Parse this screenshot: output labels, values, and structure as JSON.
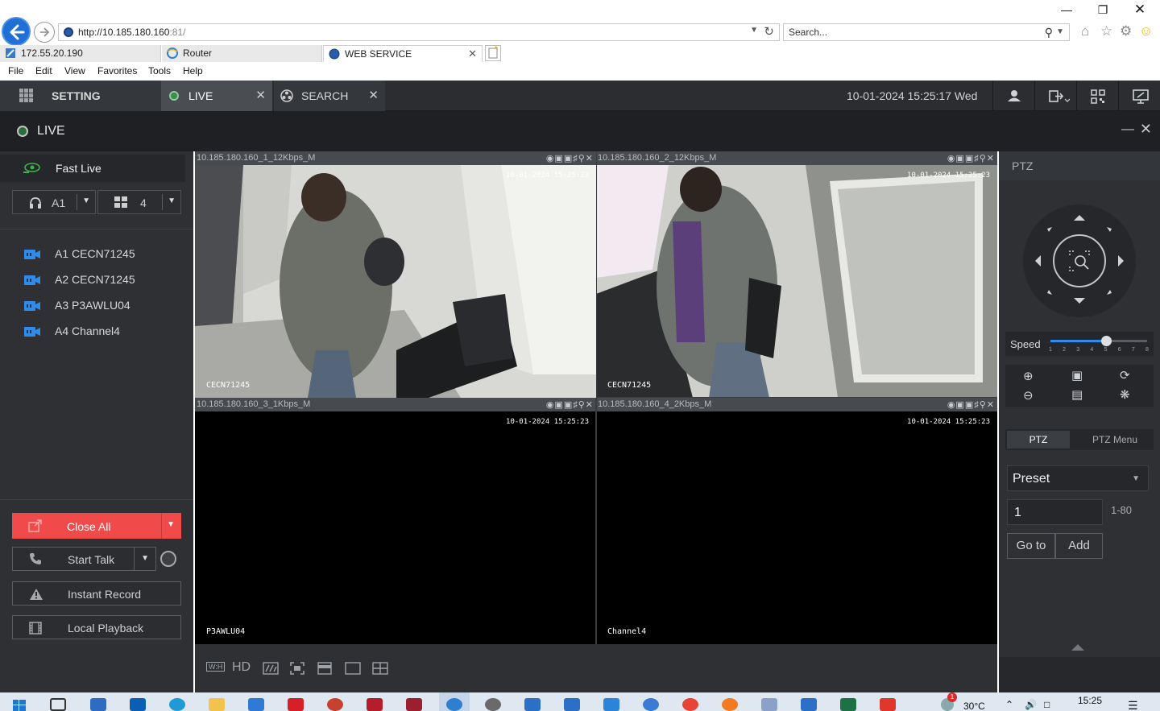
{
  "browser": {
    "address_url_host": "http://10.185.180.160",
    "address_url_rest": ":81/",
    "search_placeholder": "Search...",
    "tabs": [
      {
        "label": "172.55.20.190"
      },
      {
        "label": "Router"
      },
      {
        "label": "WEB SERVICE"
      }
    ],
    "menu": [
      "File",
      "Edit",
      "View",
      "Favorites",
      "Tools",
      "Help"
    ]
  },
  "app_header": {
    "setting_label": "SETTING",
    "live_label": "LIVE",
    "search_label": "SEARCH",
    "datetime": "10-01-2024 15:25:17 Wed"
  },
  "live_bar": {
    "title": "LIVE"
  },
  "left_panel": {
    "fast_live_label": "Fast Live",
    "stream_select": "A1",
    "layout_select": "4",
    "channels": [
      {
        "label": "A1 CECN71245"
      },
      {
        "label": "A2 CECN71245"
      },
      {
        "label": "A3 P3AWLU04"
      },
      {
        "label": "A4 Channel4"
      }
    ],
    "close_all_label": "Close All",
    "start_talk_label": "Start Talk",
    "instant_record_label": "Instant Record",
    "local_playback_label": "Local Playback"
  },
  "video_cells": [
    {
      "title": "10.185.180.160_1_12Kbps_M",
      "osd_time": "10-01-2024 15:25:23",
      "osd_name": "CECN71245"
    },
    {
      "title": "10.185.180.160_2_12Kbps_M",
      "osd_time": "10-01-2024 15:25:23",
      "osd_name": "CECN71245"
    },
    {
      "title": "10.185.180.160_3_1Kbps_M",
      "osd_time": "10-01-2024 15:25:23",
      "osd_name": "P3AWLU04"
    },
    {
      "title": "10.185.180.160_4_2Kbps_M",
      "osd_time": "10-01-2024 15:25:23",
      "osd_name": "Channel4"
    }
  ],
  "bottom_toolbar": {
    "wh_label": "W:H",
    "hd_label": "HD"
  },
  "ptz_panel": {
    "header": "PTZ",
    "speed_label": "Speed",
    "speed_value": 5,
    "speed_ticks": [
      "1",
      "2",
      "3",
      "4",
      "5",
      "6",
      "7",
      "8"
    ],
    "tab_ptz": "PTZ",
    "tab_ptz_menu": "PTZ Menu",
    "preset_select": "Preset",
    "preset_number": "1",
    "preset_range": "1-80",
    "goto_label": "Go to",
    "add_label": "Add"
  },
  "taskbar": {
    "temperature": "30°C",
    "time": "15:25",
    "notification_count": "1"
  },
  "colors": {
    "header_bg": "#2b2d30",
    "panel_bg": "#2e3033",
    "accent_red": "#f04a4a",
    "accent_blue": "#2d8cf0",
    "active_cell_border": "#37b24d"
  }
}
